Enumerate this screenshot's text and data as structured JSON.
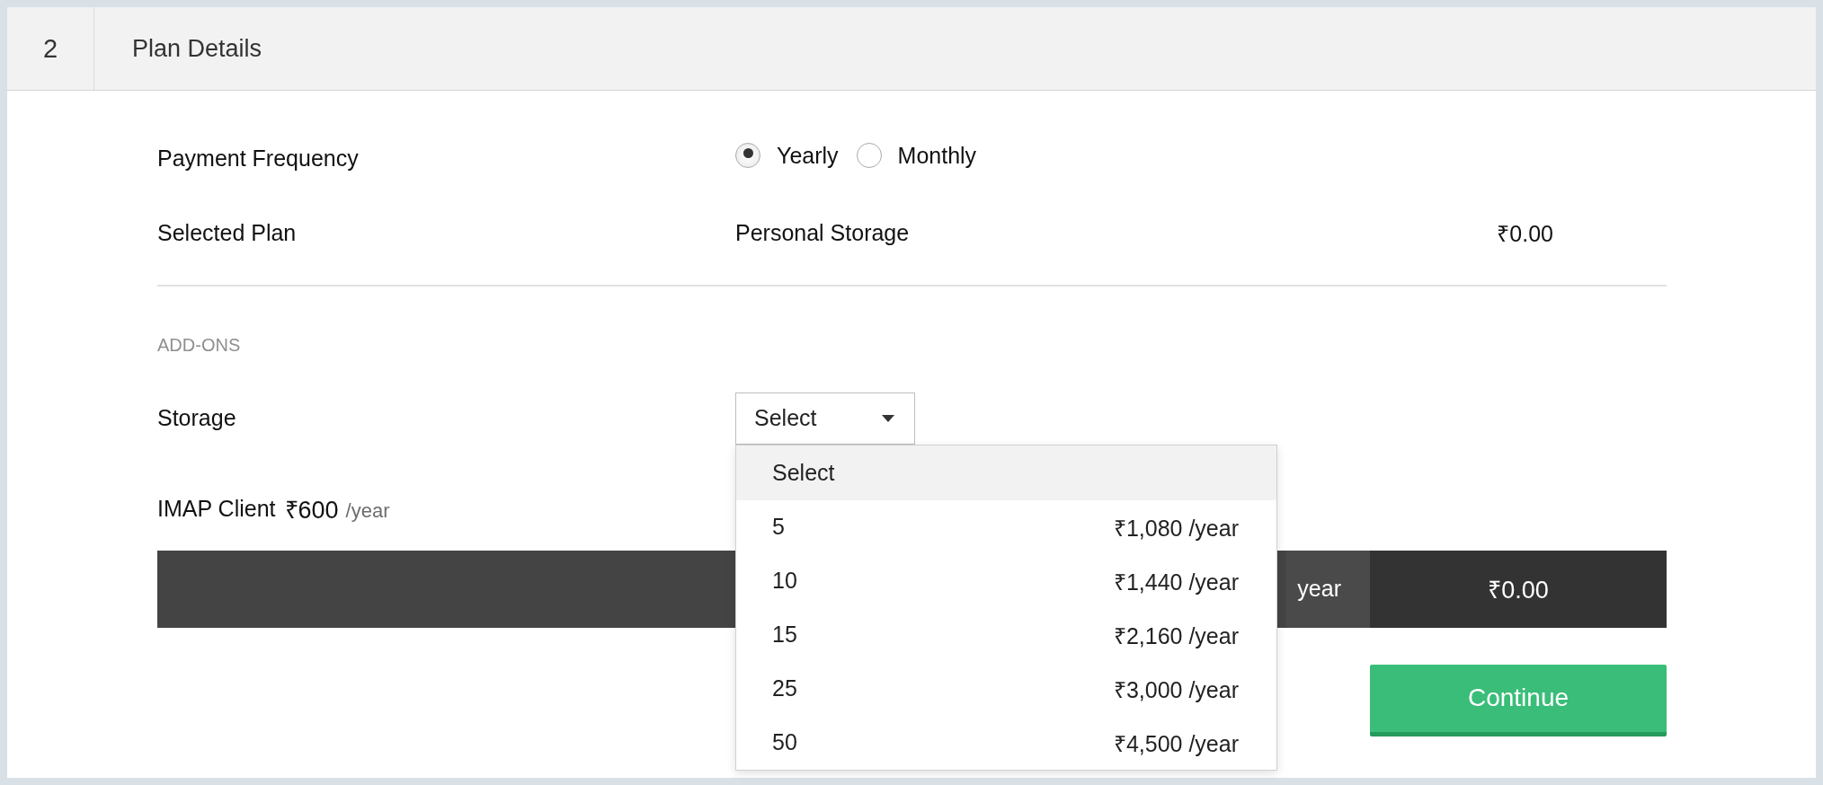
{
  "section": {
    "number": "2",
    "title": "Plan Details"
  },
  "payment_frequency": {
    "label": "Payment Frequency",
    "options": [
      {
        "label": "Yearly",
        "selected": true
      },
      {
        "label": "Monthly",
        "selected": false
      }
    ]
  },
  "selected_plan": {
    "label": "Selected Plan",
    "name": "Personal Storage",
    "price": "₹0.00"
  },
  "addons": {
    "heading": "ADD-ONS",
    "storage": {
      "label": "Storage",
      "value": "Select",
      "expanded": true,
      "options": [
        {
          "label": "Select",
          "selected": true
        },
        {
          "label": "5",
          "price": "₹1,080 /year",
          "selected": false
        },
        {
          "label": "10",
          "price": "₹1,440 /year",
          "selected": false
        },
        {
          "label": "15",
          "price": "₹2,160 /year",
          "selected": false
        },
        {
          "label": "25",
          "price": "₹3,000 /year",
          "selected": false
        },
        {
          "label": "50",
          "price": "₹4,500 /year",
          "selected": false
        }
      ]
    },
    "imap": {
      "label": "IMAP Client",
      "price": "₹600",
      "period": "/year"
    }
  },
  "total_bar": {
    "label": "year",
    "amount": "₹0.00"
  },
  "continue_button": "Continue"
}
